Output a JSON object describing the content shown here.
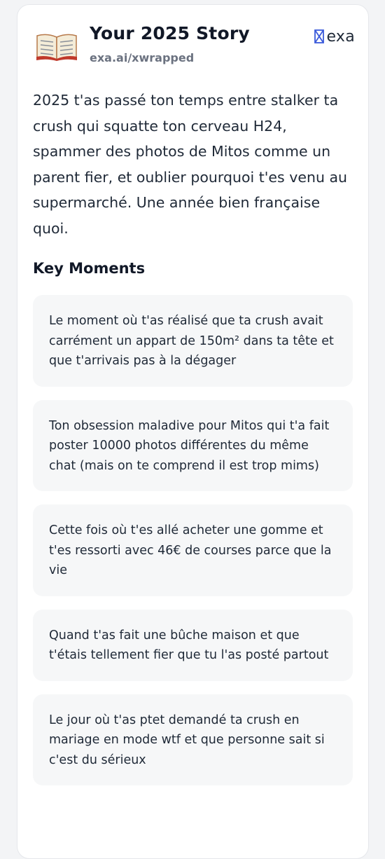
{
  "header": {
    "title": "Your 2025 Story",
    "subtitle": "exa.ai/xwrapped",
    "icon": "open-book-icon",
    "brand": {
      "text": "exa",
      "icon": "exa-logo-icon",
      "color": "#3b5bdb"
    }
  },
  "story": {
    "text": "2025 t'as passé ton temps entre stalker ta crush qui squatte ton cerveau H24, spammer des photos de Mitos comme un parent fier, et oublier pourquoi t'es venu au supermarché. Une année bien française quoi."
  },
  "key_moments": {
    "title": "Key Moments",
    "items": [
      "Le moment où t'as réalisé que ta crush avait carrément un appart de 150m² dans ta tête et que t'arrivais pas à la dégager",
      "Ton obsession maladive pour Mitos qui t'a fait poster 10000 photos différentes du même chat (mais on te comprend il est trop mims)",
      "Cette fois où t'es allé acheter une gomme et t'es ressorti avec 46€ de courses parce que la vie",
      "Quand t'as fait une bûche maison et que t'étais tellement fier que tu l'as posté partout",
      "Le jour où t'as ptet demandé ta crush en mariage en mode wtf et que personne sait si c'est du sérieux"
    ]
  },
  "colors": {
    "card_background": "#ffffff",
    "page_background": "#f3f4f6",
    "moment_background": "#f6f7f8",
    "text": "#1f2937",
    "muted": "#6b7280"
  }
}
